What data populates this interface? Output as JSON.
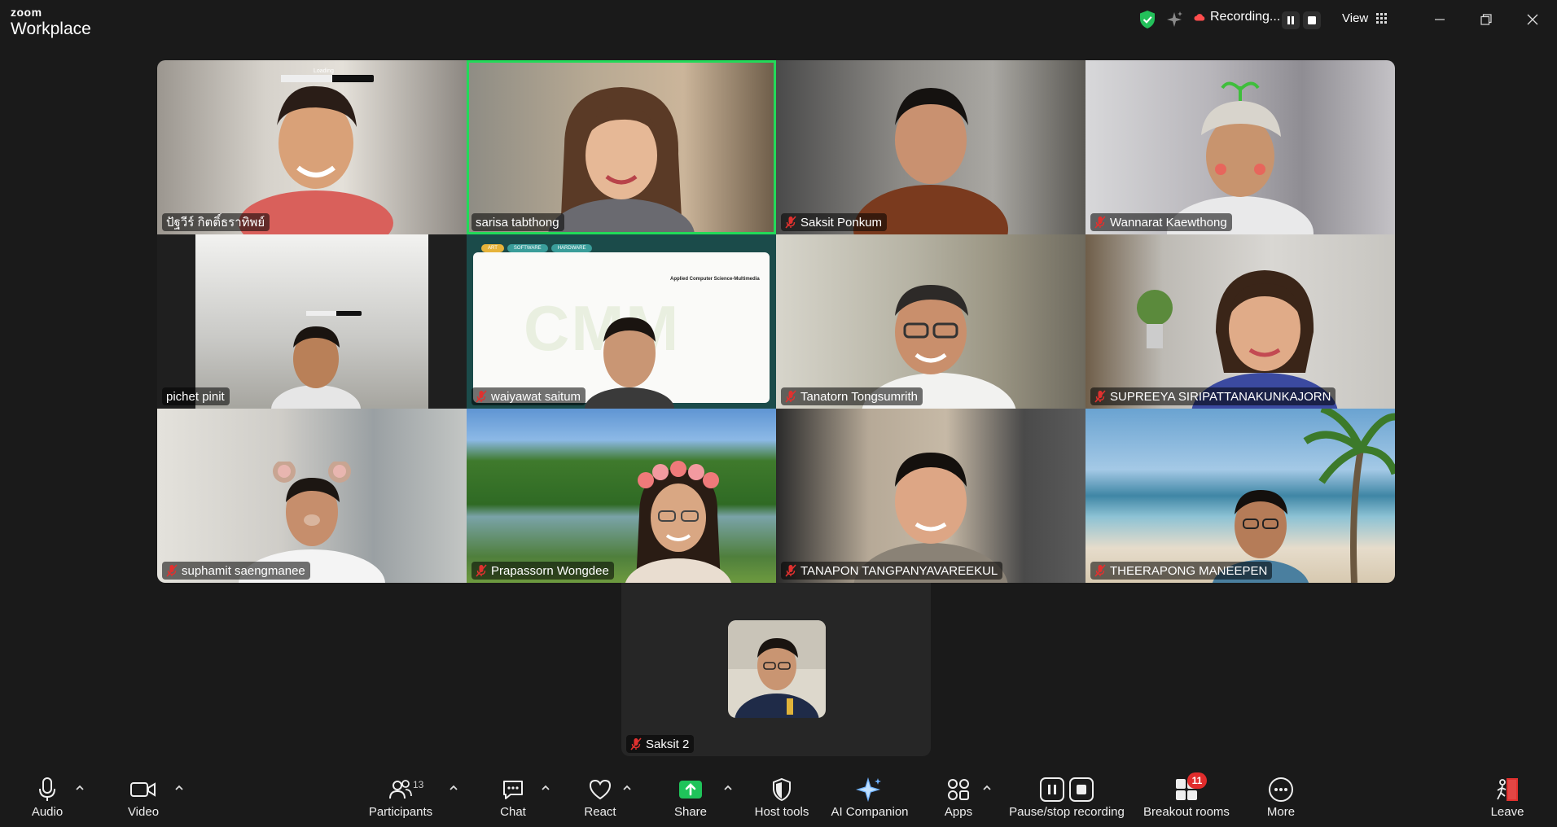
{
  "app": {
    "brand_top": "zoom",
    "brand_bottom": "Workplace"
  },
  "titlebar": {
    "recording_label": "Recording...",
    "view_label": "View"
  },
  "participants": [
    {
      "name": "ปัฐวีร์ กิตติ์ธราทิพย์",
      "muted": false,
      "active_speaker": false,
      "bg": "#b9b4ac",
      "loading": "Loading"
    },
    {
      "name": "sarisa tabthong",
      "muted": false,
      "active_speaker": true,
      "bg": "#a6927a"
    },
    {
      "name": "Saksit Ponkum",
      "muted": true,
      "active_speaker": false,
      "bg": "#6d6a66"
    },
    {
      "name": "Wannarat Kaewthong",
      "muted": true,
      "active_speaker": false,
      "bg": "#a9a8ab"
    },
    {
      "name": "pichet pinit",
      "muted": false,
      "active_speaker": false,
      "bg": "#cfcfcd"
    },
    {
      "name": "waiyawat saitum",
      "muted": true,
      "active_speaker": false,
      "bg": "#1b4b4a",
      "slide": {
        "tabs": [
          "ART",
          "SOFTWARE",
          "HARDWARE"
        ],
        "title": "Applied Computer Science-Multimedia",
        "watermark": "CMM"
      }
    },
    {
      "name": "Tanatorn Tongsumrith",
      "muted": true,
      "active_speaker": false,
      "bg": "#8d8b7f"
    },
    {
      "name": "SUPREEYA SIRIPATTANAKUNKAJORN",
      "muted": true,
      "active_speaker": false,
      "bg": "#c3c0bc"
    },
    {
      "name": "suphamit saengmanee",
      "muted": true,
      "active_speaker": false,
      "bg": "#bfbdbb"
    },
    {
      "name": "Prapassorn Wongdee",
      "muted": true,
      "active_speaker": false,
      "bg": "#4f7f3c"
    },
    {
      "name": "TANAPON TANGPANYAVAREEKUL",
      "muted": true,
      "active_speaker": false,
      "bg": "#7e7a76"
    },
    {
      "name": "THEERAPONG MANEEPEN",
      "muted": true,
      "active_speaker": false,
      "bg": "#7ab0d6"
    }
  ],
  "self_view": {
    "name": "Saksit 2",
    "muted": true
  },
  "toolbar": {
    "audio": "Audio",
    "video": "Video",
    "participants": "Participants",
    "participants_count": "13",
    "chat": "Chat",
    "react": "React",
    "share": "Share",
    "host_tools": "Host tools",
    "ai_companion": "AI Companion",
    "apps": "Apps",
    "pause_stop": "Pause/stop recording",
    "breakout": "Breakout rooms",
    "breakout_badge": "11",
    "more": "More",
    "leave": "Leave"
  },
  "colors": {
    "accent_green": "#23d959",
    "share_green": "#1fc35a",
    "badge_red": "#e02c2c",
    "leave_red": "#e0312f"
  }
}
